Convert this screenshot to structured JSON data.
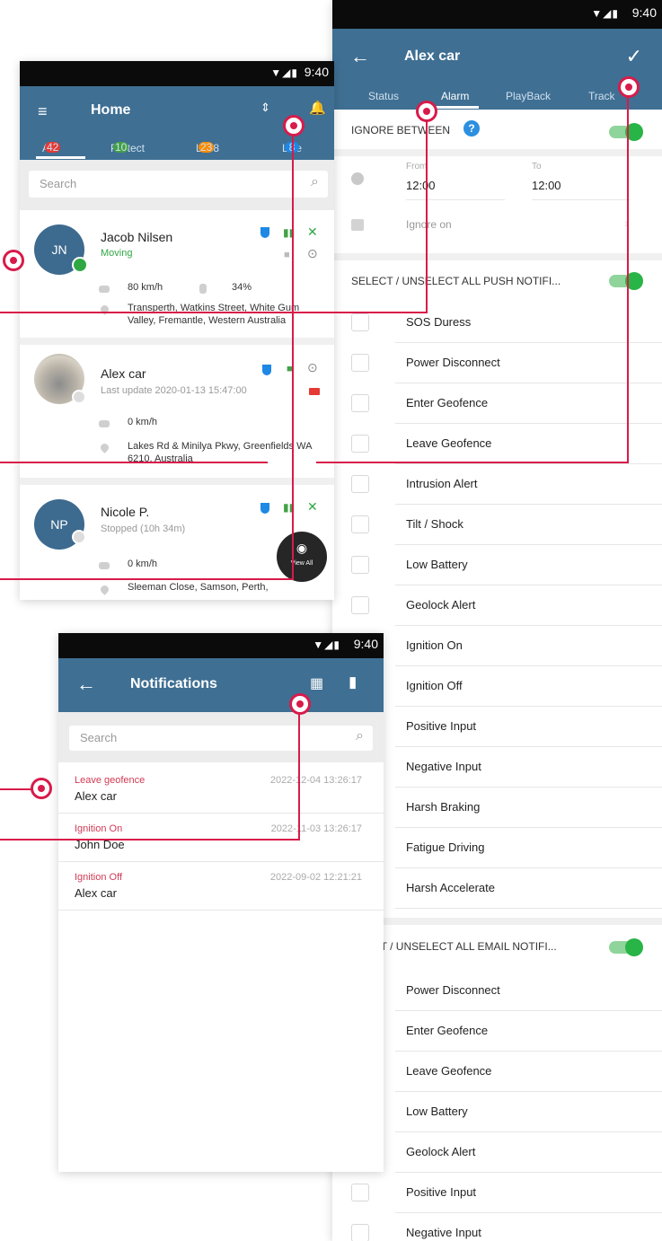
{
  "status_bar": {
    "time": "9:40",
    "signal_icons": "wifi-signal-battery-icons"
  },
  "colors": {
    "appbar": "#3f6f93",
    "accent_callout": "#d81b4a",
    "toggle_on": "#28b446",
    "moving_green": "#2fa844"
  },
  "home": {
    "title": "Home",
    "tabs": [
      {
        "label": "All",
        "badge": "42",
        "badge_color": "#e53935"
      },
      {
        "label": "Protect",
        "badge": "10",
        "badge_color": "#43a047"
      },
      {
        "label": "Loc8",
        "badge": "23",
        "badge_color": "#fb8c00"
      },
      {
        "label": "Live",
        "badge": "8",
        "badge_color": "#1e88e5"
      }
    ],
    "search_placeholder": "Search",
    "vehicles": [
      {
        "initials": "JN",
        "name": "Jacob Nilsen",
        "status": "Moving",
        "speed": "80 km/h",
        "battery": "34%",
        "address": "Transperth, Watkins Street, White Gum Valley, Fremantle, Western Australia"
      },
      {
        "initials": "",
        "name": "Alex car",
        "status": "Last update 2020-01-13 15:47:00",
        "speed": "0 km/h",
        "address": "Lakes Rd & Minilya Pkwy, Greenfields WA 6210, Australia"
      },
      {
        "initials": "NP",
        "name": "Nicole P.",
        "status": "Stopped (10h 34m)",
        "speed": "0 km/h",
        "address": "Sleeman Close, Samson, Perth,"
      }
    ],
    "fab_label": "View All"
  },
  "alarm": {
    "title": "Alex car",
    "tabs": [
      "Status",
      "Alarm",
      "PlayBack",
      "Track"
    ],
    "active_tab": "Alarm",
    "ignore_between_label": "IGNORE BETWEEN",
    "from_label": "From",
    "from_value": "12:00",
    "to_label": "To",
    "to_value": "12:00",
    "ignore_on_label": "Ignore on",
    "push_section_label": "SELECT / UNSELECT ALL PUSH NOTIFI...",
    "push_items": [
      "SOS Duress",
      "Power Disconnect",
      "Enter Geofence",
      "Leave Geofence",
      "Intrusion Alert",
      "Tilt / Shock",
      "Low Battery",
      "Geolock Alert",
      "Ignition On",
      "Ignition Off",
      "Positive Input",
      "Negative Input",
      "Harsh Braking",
      "Fatigue Driving",
      "Harsh Accelerate"
    ],
    "email_section_label": "CT / UNSELECT ALL EMAIL NOTIFI...",
    "email_items": [
      "Power Disconnect",
      "Enter Geofence",
      "Leave Geofence",
      "Low Battery",
      "Geolock Alert",
      "Positive Input",
      "Negative Input"
    ]
  },
  "notifications": {
    "title": "Notifications",
    "search_placeholder": "Search",
    "items": [
      {
        "type": "Leave geofence",
        "name": "Alex car",
        "time": "2022-12-04 13:26:17"
      },
      {
        "type": "Ignition On",
        "name": "John Doe",
        "time": "2022-11-03 13:26:17"
      },
      {
        "type": "Ignition Off",
        "name": "Alex car",
        "time": "2022-09-02 12:21:21"
      }
    ]
  }
}
